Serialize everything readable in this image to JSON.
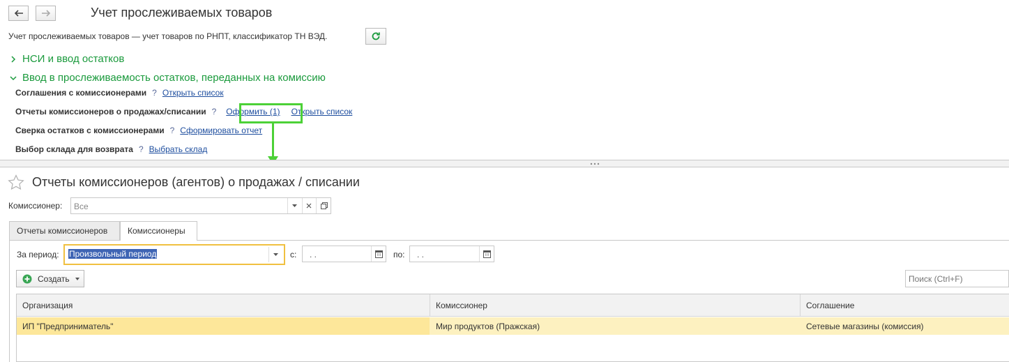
{
  "top": {
    "title": "Учет прослеживаемых товаров",
    "description": "Учет прослеживаемых товаров — учет товаров по РНПТ, классификатор ТН ВЭД.",
    "groups": {
      "nsi": "НСИ и ввод остатков",
      "commission": "Ввод в прослеживаемость остатков, переданных на комиссию"
    },
    "rows": [
      {
        "label": "Соглашения с комиссионерами",
        "help": "?",
        "link1": "Открыть список"
      },
      {
        "label": "Отчеты комиссионеров о продажах/списании",
        "help": "?",
        "link1": "Оформить (1)",
        "link2": "Открыть список"
      },
      {
        "label": "Сверка остатков с комиссионерами",
        "help": "?",
        "link1": "Сформировать отчет"
      },
      {
        "label": "Выбор склада для возврата",
        "help": "?",
        "link1": "Выбрать склад"
      }
    ]
  },
  "bottom": {
    "title": "Отчеты комиссионеров (агентов) о продажах / списании",
    "commissioner_label": "Комиссионер:",
    "commissioner_value": "Все",
    "tabs": [
      "Отчеты комиссионеров",
      "Комиссионеры"
    ],
    "period_label": "За период:",
    "period_value": "Произвольный период",
    "from_label": "с:",
    "to_label": "по:",
    "date_mask": ".   .",
    "create_label": "Создать",
    "search_placeholder": "Поиск (Ctrl+F)",
    "table": {
      "columns": [
        "Организация",
        "Комиссионер",
        "Соглашение"
      ],
      "rows": [
        [
          "ИП \"Предприниматель\"",
          "Мир продуктов (Пражская)",
          "Сетевые магазины (комиссия)"
        ]
      ]
    }
  },
  "colors": {
    "accent_green": "#1a9a3c",
    "highlight_box": "#4cd137",
    "row_selected": "#fde79a",
    "period_border": "#f0c040"
  }
}
